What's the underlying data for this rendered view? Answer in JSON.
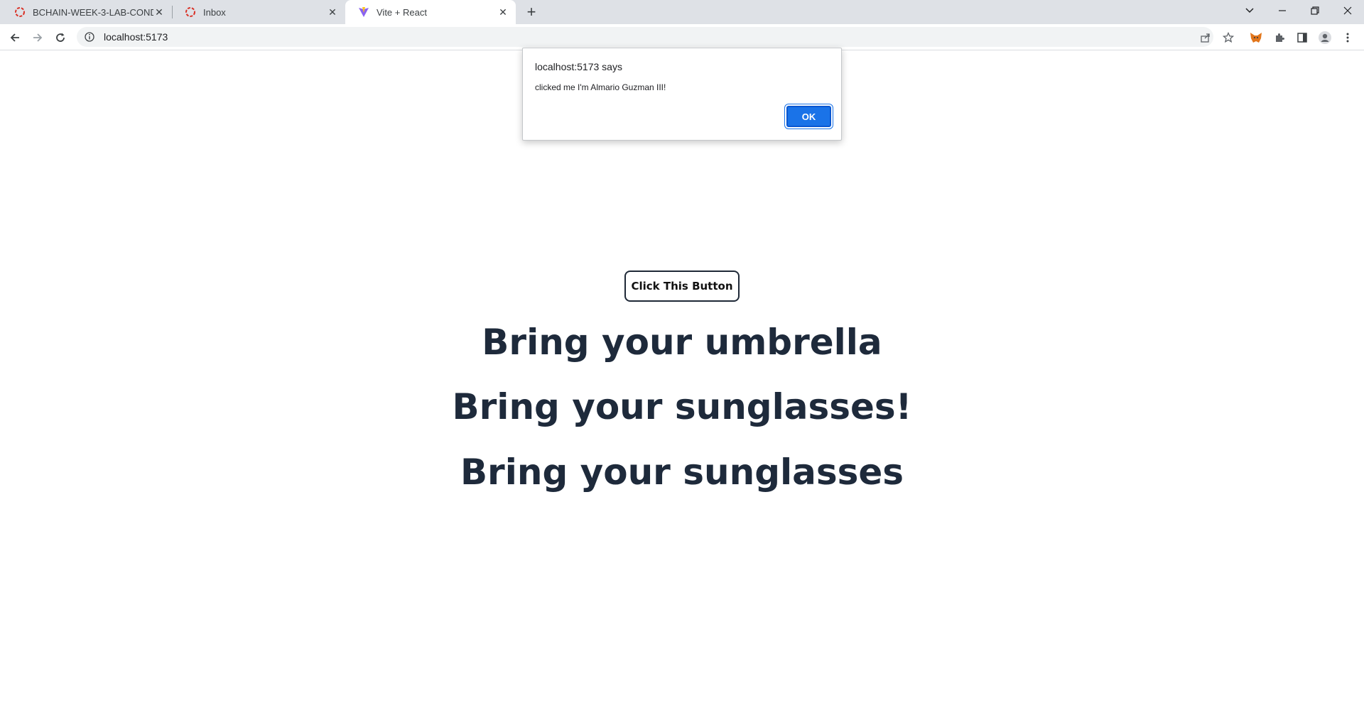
{
  "browser": {
    "tabs": [
      {
        "title": "BCHAIN-WEEK-3-LAB-CONDITIO",
        "icon": "red-dashed-circle-icon"
      },
      {
        "title": "Inbox",
        "icon": "red-dashed-circle-icon"
      },
      {
        "title": "Vite + React",
        "icon": "vite-logo-icon",
        "active": true
      }
    ],
    "url": "localhost:5173"
  },
  "page": {
    "button_label": "Click This Button",
    "messages": [
      "Bring your umbrella",
      "Bring your sunglasses!",
      "Bring your sunglasses"
    ]
  },
  "alert": {
    "title": "localhost:5173 says",
    "message": "clicked me I'm Almario Guzman III!",
    "ok_label": "OK"
  },
  "colors": {
    "accent": "#1a73e8",
    "heading": "#1e2a3b",
    "tabstrip": "#dee1e6"
  }
}
